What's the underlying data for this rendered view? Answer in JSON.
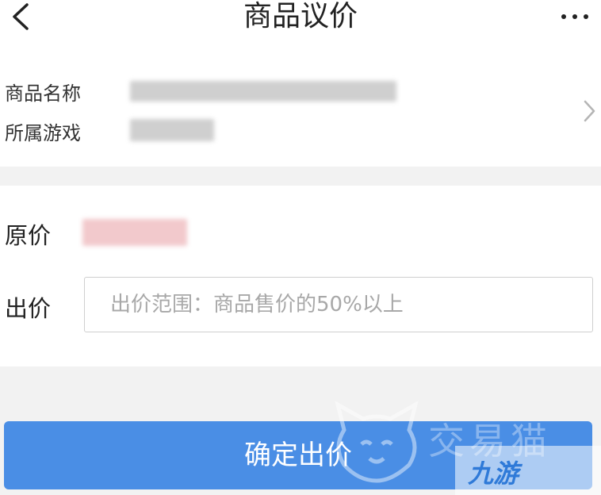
{
  "nav": {
    "title": "商品议价",
    "back_icon": "back-arrow-icon",
    "more_icon": "more-dots-icon"
  },
  "product": {
    "name_label": "商品名称",
    "game_label": "所属游戏",
    "chevron_icon": "chevron-right-icon"
  },
  "price": {
    "original_label": "原价",
    "offer_label": "出价",
    "offer_placeholder": "出价范围：商品售价的50%以上",
    "offer_value": ""
  },
  "actions": {
    "confirm_label": "确定出价",
    "accent_color": "#4a8ee5"
  },
  "watermark": {
    "brand_text": "交易猫",
    "badge_text": "九游"
  }
}
